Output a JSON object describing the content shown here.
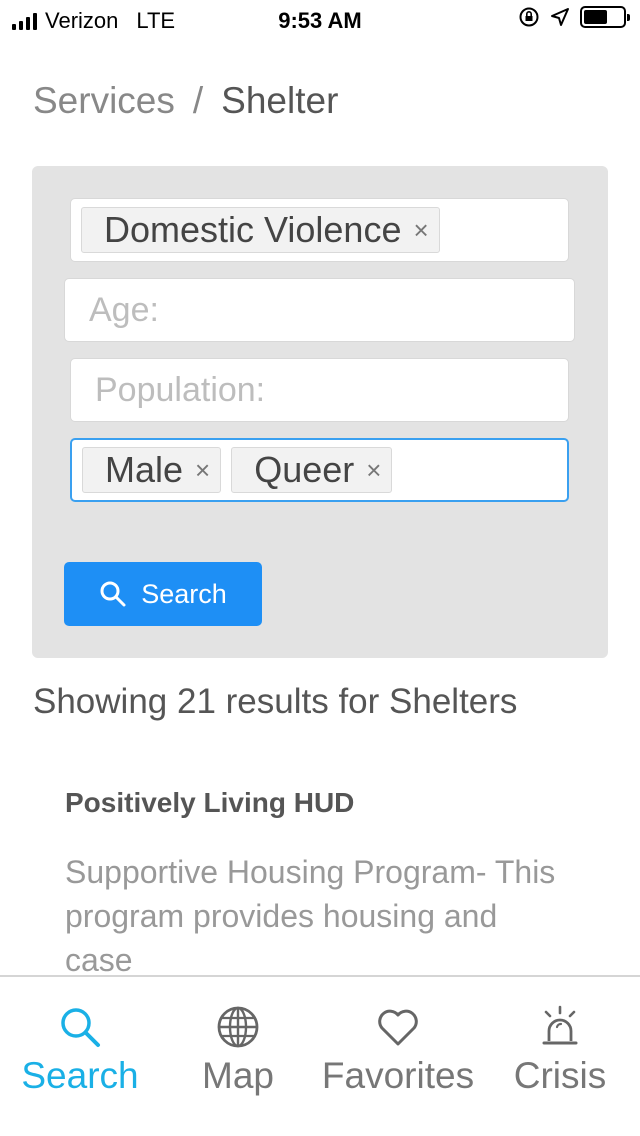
{
  "status_bar": {
    "carrier": "Verizon",
    "network": "LTE",
    "time": "9:53 AM",
    "battery_level": 0.6
  },
  "breadcrumb": {
    "parent": "Services",
    "separator": "/",
    "current": "Shelter"
  },
  "filters": {
    "service_type_tags": [
      {
        "label": "Domestic Violence",
        "remove": "×"
      }
    ],
    "age_placeholder": "Age:",
    "population_placeholder": "Population:",
    "population_tags": [
      {
        "label": "Male",
        "remove": "×"
      },
      {
        "label": "Queer",
        "remove": "×"
      }
    ],
    "search_button_label": "Search"
  },
  "results": {
    "heading": "Showing 21 results for Shelters",
    "items": [
      {
        "title": "Positively Living HUD",
        "description": "Supportive Housing Program- This program provides housing and case"
      }
    ]
  },
  "tabbar": {
    "tabs": [
      {
        "label": "Search",
        "icon": "search-icon",
        "active": true
      },
      {
        "label": "Map",
        "icon": "globe-icon",
        "active": false
      },
      {
        "label": "Favorites",
        "icon": "heart-icon",
        "active": false
      },
      {
        "label": "Crisis",
        "icon": "siren-icon",
        "active": false
      }
    ]
  },
  "colors": {
    "accent": "#1e8ff5",
    "tab_active": "#1ab0e6",
    "panel_bg": "#e3e3e3"
  }
}
